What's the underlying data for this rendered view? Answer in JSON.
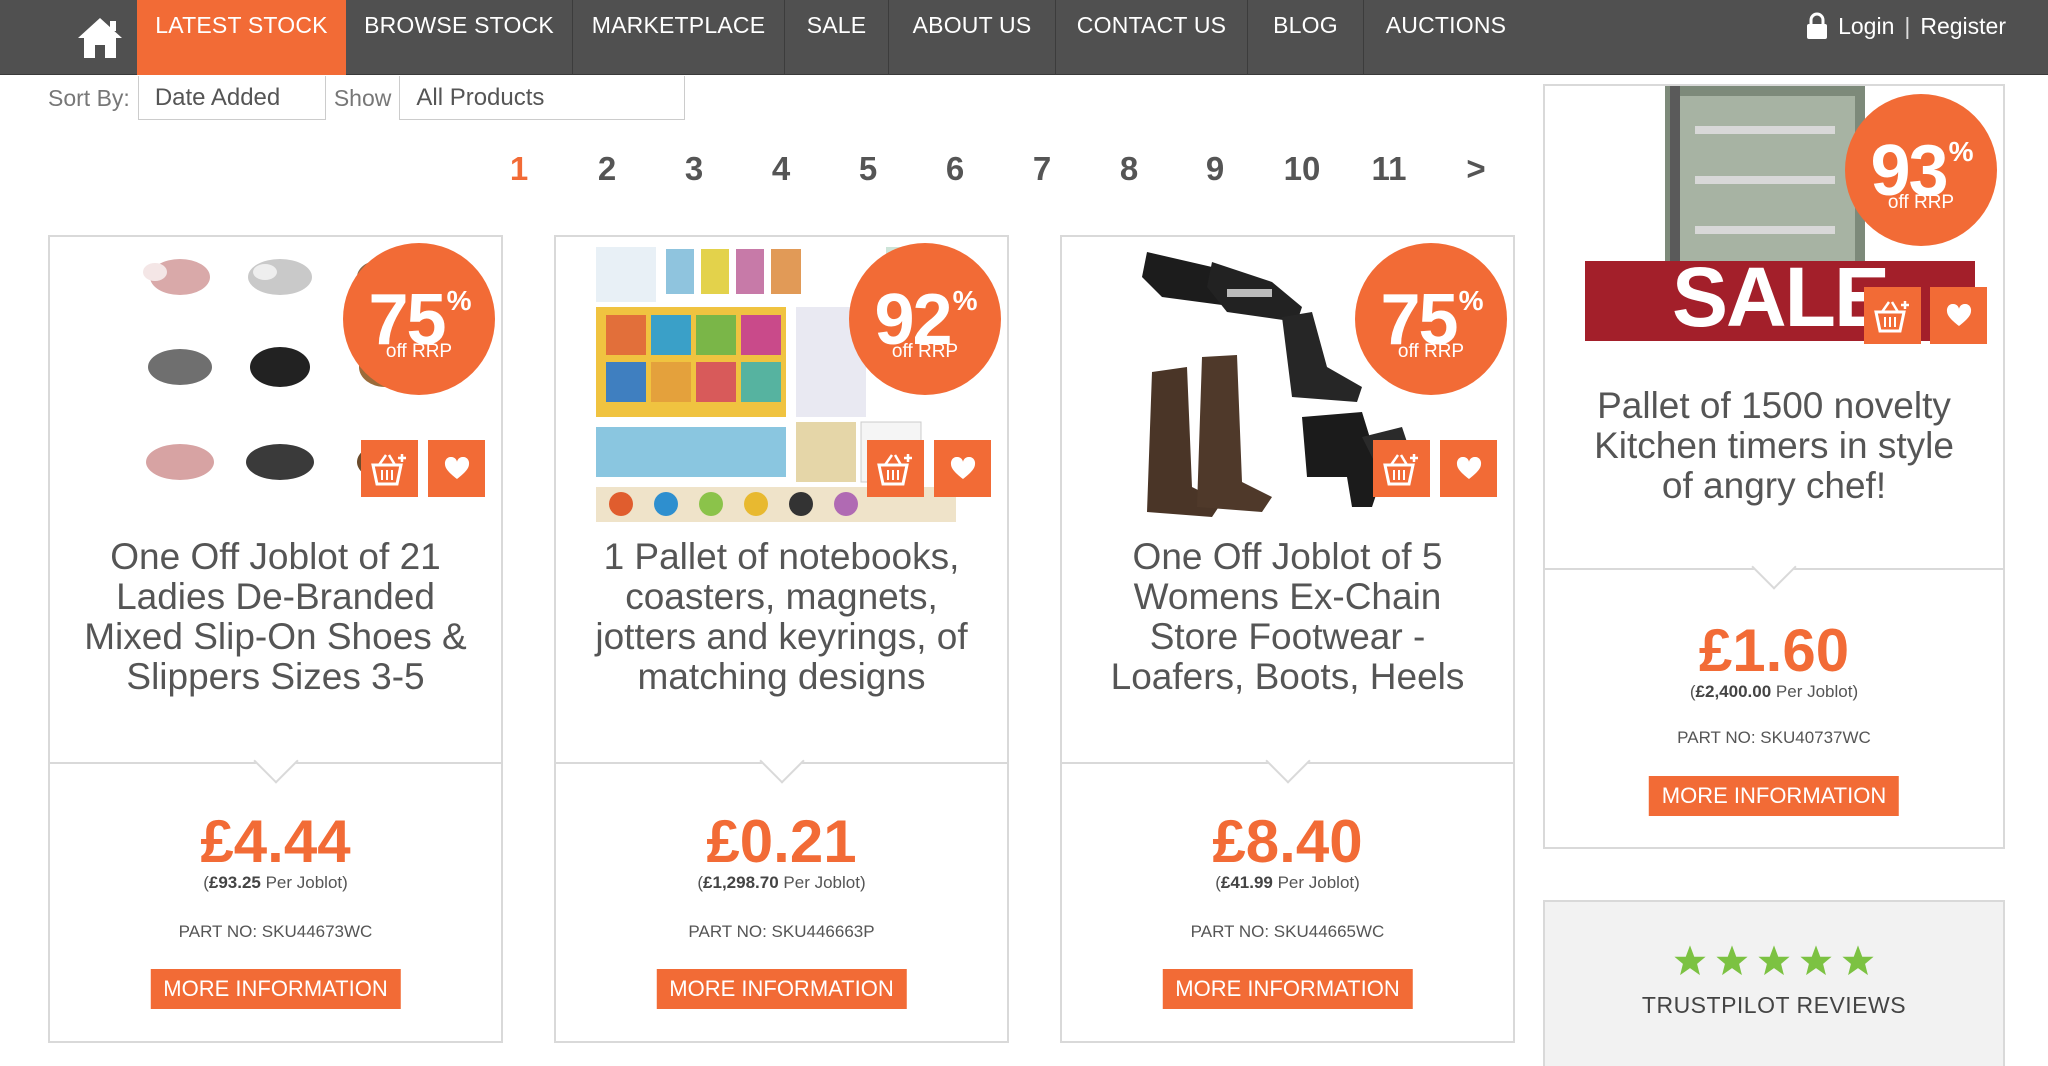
{
  "nav": {
    "items": [
      "LATEST STOCK",
      "BROWSE STOCK",
      "MARKETPLACE",
      "SALE",
      "ABOUT US",
      "CONTACT US",
      "BLOG",
      "AUCTIONS"
    ],
    "login": "Login",
    "separator": "|",
    "register": "Register"
  },
  "sort": {
    "label": "Sort By:",
    "value": "Date Added",
    "show_label": "Show",
    "show_value": "All Products"
  },
  "pagination": {
    "pages": [
      "1",
      "2",
      "3",
      "4",
      "5",
      "6",
      "7",
      "8",
      "9",
      "10",
      "11"
    ],
    "next": ">",
    "current": "1"
  },
  "products": [
    {
      "discount": "75",
      "pct_sign": "%",
      "off": "off RRP",
      "title": "One Off Joblot of 21 Ladies De-Branded Mixed Slip-On Shoes & Slippers Sizes 3-5",
      "price": "£4.44",
      "per_open": "(",
      "per_price": "£93.25",
      "per_text": " Per Joblot)",
      "part": "PART NO: SKU44673WC",
      "more": "MORE INFORMATION"
    },
    {
      "discount": "92",
      "pct_sign": "%",
      "off": "off RRP",
      "title": "1 Pallet of notebooks, coasters, magnets, jotters and keyrings, of matching designs",
      "price": "£0.21",
      "per_open": "(",
      "per_price": "£1,298.70",
      "per_text": " Per Joblot)",
      "part": "PART NO: SKU446663P",
      "more": "MORE INFORMATION"
    },
    {
      "discount": "75",
      "pct_sign": "%",
      "off": "off RRP",
      "title": "One Off Joblot of 5 Womens Ex-Chain Store Footwear - Loafers, Boots, Heels",
      "price": "£8.40",
      "per_open": "(",
      "per_price": "£41.99",
      "per_text": " Per Joblot)",
      "part": "PART NO: SKU44665WC",
      "more": "MORE INFORMATION"
    }
  ],
  "side": {
    "discount": "93",
    "pct_sign": "%",
    "off": "off RRP",
    "banner": "SALE",
    "title": "Pallet of 1500 novelty Kitchen timers in style of angry chef!",
    "price": "£1.60",
    "per_open": "(",
    "per_price": "£2,400.00",
    "per_text": " Per Joblot)",
    "part": "PART NO: SKU40737WC",
    "more": "MORE INFORMATION"
  },
  "trustpilot": {
    "label": "TRUSTPILOT REVIEWS",
    "stars": 5,
    "star_color": "#7cc242"
  },
  "colors": {
    "accent": "#f26b36",
    "nav_bg": "#505050"
  }
}
